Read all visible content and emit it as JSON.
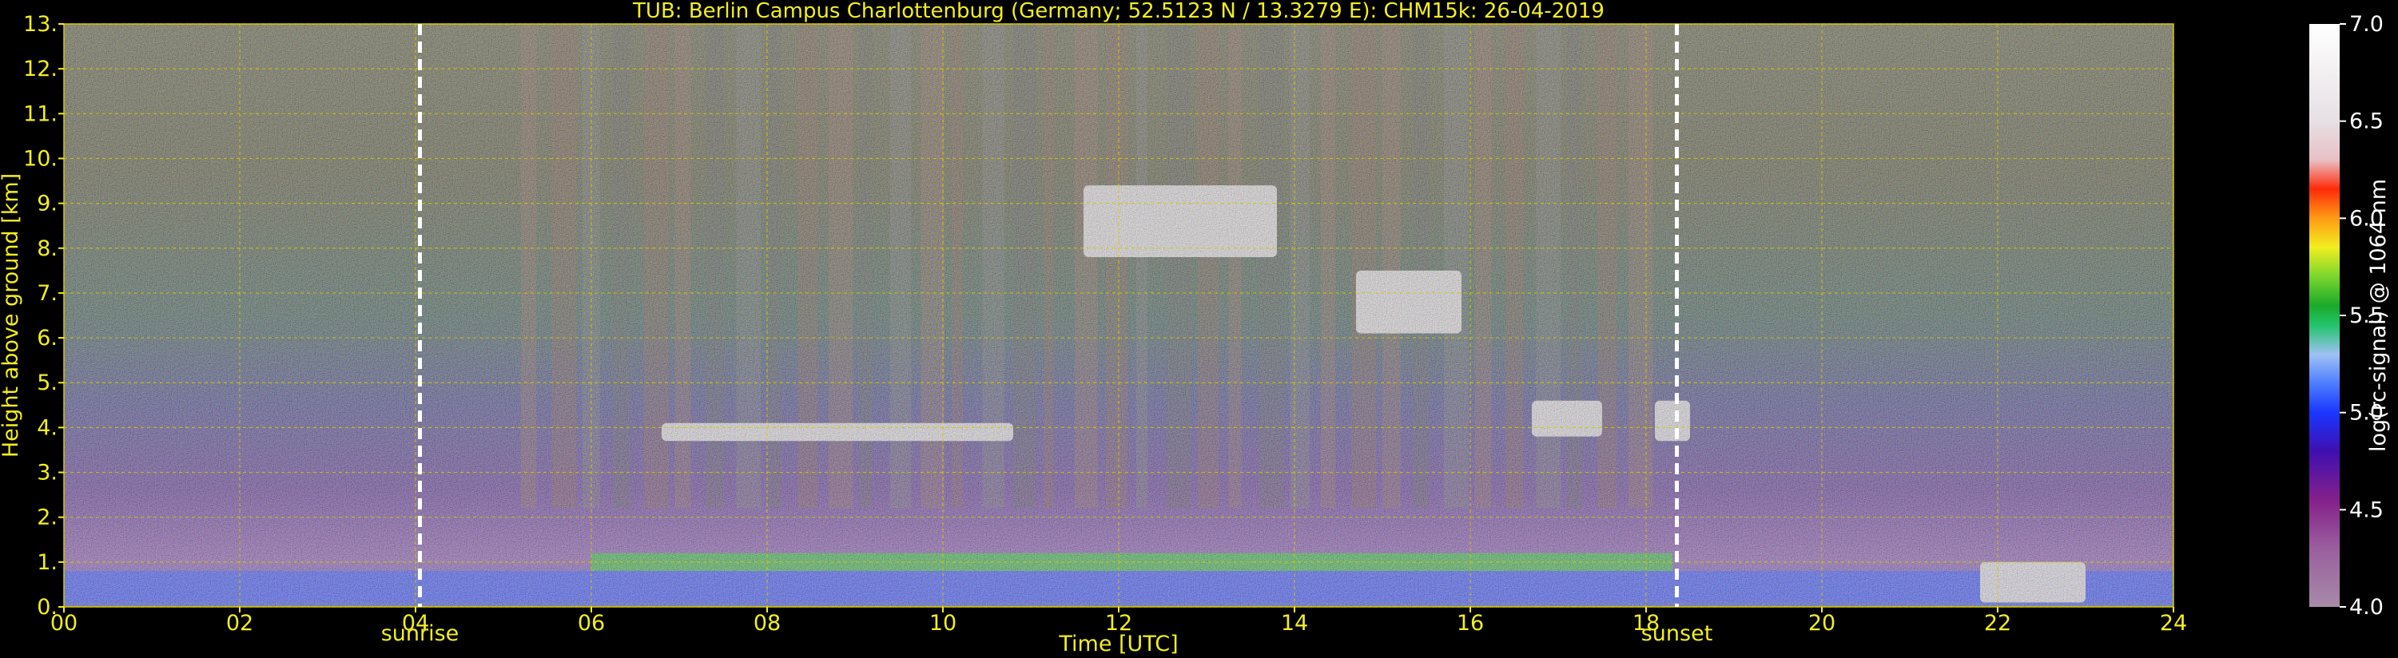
{
  "chart_data": {
    "type": "heatmap",
    "title": "TUB: Berlin Campus Charlottenburg (Germany; 52.5123 N / 13.3279 E):    CHM15k: 26-04-2019",
    "xlabel": "Time [UTC]",
    "ylabel": "Height above ground [km]",
    "xlim": [
      0,
      24
    ],
    "ylim": [
      0,
      13
    ],
    "x_ticks": [
      {
        "value": 0,
        "label": "00"
      },
      {
        "value": 2,
        "label": "02"
      },
      {
        "value": 4,
        "label": "04"
      },
      {
        "value": 6,
        "label": "06"
      },
      {
        "value": 8,
        "label": "08"
      },
      {
        "value": 10,
        "label": "10"
      },
      {
        "value": 12,
        "label": "12"
      },
      {
        "value": 14,
        "label": "14"
      },
      {
        "value": 16,
        "label": "16"
      },
      {
        "value": 18,
        "label": "18"
      },
      {
        "value": 20,
        "label": "20"
      },
      {
        "value": 22,
        "label": "22"
      },
      {
        "value": 24,
        "label": "24"
      }
    ],
    "y_ticks": [
      {
        "value": 0,
        "label": "0."
      },
      {
        "value": 1,
        "label": "1."
      },
      {
        "value": 2,
        "label": "2."
      },
      {
        "value": 3,
        "label": "3."
      },
      {
        "value": 4,
        "label": "4."
      },
      {
        "value": 5,
        "label": "5."
      },
      {
        "value": 6,
        "label": "6."
      },
      {
        "value": 7,
        "label": "7."
      },
      {
        "value": 8,
        "label": "8."
      },
      {
        "value": 9,
        "label": "9."
      },
      {
        "value": 10,
        "label": "10."
      },
      {
        "value": 11,
        "label": "11."
      },
      {
        "value": 12,
        "label": "12."
      },
      {
        "value": 13,
        "label": "13."
      }
    ],
    "grid": true,
    "grid_color": "#d4c800",
    "markers": [
      {
        "time": 4.05,
        "label": "sunrise"
      },
      {
        "time": 18.35,
        "label": "sunset"
      }
    ],
    "colorbar": {
      "label": "log(rc-signal) @ 1064 nm",
      "range": [
        4.0,
        7.0
      ],
      "ticks": [
        {
          "value": 4.0,
          "label": "4.0"
        },
        {
          "value": 4.5,
          "label": "4.5"
        },
        {
          "value": 5.0,
          "label": "5.0"
        },
        {
          "value": 5.5,
          "label": "5.5"
        },
        {
          "value": 6.0,
          "label": "6.0"
        },
        {
          "value": 6.5,
          "label": "6.5"
        },
        {
          "value": 7.0,
          "label": "7.0"
        }
      ],
      "stops": [
        {
          "value": 4.0,
          "color": "#a78aa8"
        },
        {
          "value": 4.3,
          "color": "#9a5f9e"
        },
        {
          "value": 4.55,
          "color": "#84208a"
        },
        {
          "value": 4.8,
          "color": "#3f0fb0"
        },
        {
          "value": 5.0,
          "color": "#1a36ff"
        },
        {
          "value": 5.15,
          "color": "#4d7dff"
        },
        {
          "value": 5.3,
          "color": "#9ec1f3"
        },
        {
          "value": 5.45,
          "color": "#22c46b"
        },
        {
          "value": 5.55,
          "color": "#1aaa2a"
        },
        {
          "value": 5.7,
          "color": "#7bd62d"
        },
        {
          "value": 5.85,
          "color": "#f2ee1f"
        },
        {
          "value": 6.0,
          "color": "#ff9a14"
        },
        {
          "value": 6.15,
          "color": "#ff2a0a"
        },
        {
          "value": 6.3,
          "color": "#e8c0c6"
        },
        {
          "value": 6.5,
          "color": "#e6e0e4"
        },
        {
          "value": 7.0,
          "color": "#ffffff"
        }
      ]
    },
    "features": [
      {
        "kind": "boundary_layer",
        "band": "green",
        "t_start": 6.0,
        "t_end": 18.3,
        "height_km": [
          0.8,
          1.2
        ]
      },
      {
        "kind": "boundary_layer",
        "band": "blue",
        "t_start": 0.0,
        "t_end": 24.0,
        "height_km": [
          0.1,
          0.8
        ]
      },
      {
        "kind": "cloud",
        "t_start": 6.8,
        "t_end": 10.8,
        "height_km": [
          3.7,
          4.1
        ]
      },
      {
        "kind": "cloud",
        "t_start": 11.6,
        "t_end": 13.8,
        "height_km": [
          7.8,
          9.4
        ]
      },
      {
        "kind": "cloud",
        "t_start": 14.7,
        "t_end": 15.9,
        "height_km": [
          6.1,
          7.5
        ]
      },
      {
        "kind": "cloud",
        "t_start": 16.7,
        "t_end": 17.5,
        "height_km": [
          3.8,
          4.6
        ]
      },
      {
        "kind": "cloud",
        "t_start": 18.1,
        "t_end": 18.5,
        "height_km": [
          3.7,
          4.6
        ]
      },
      {
        "kind": "cloud",
        "t_start": 21.8,
        "t_end": 23.0,
        "height_km": [
          0.1,
          1.0
        ]
      }
    ]
  },
  "icons": {
    "sunrise_marker": "dashed-white-vertical-line",
    "sunset_marker": "dashed-white-vertical-line"
  },
  "colors": {
    "background": "#000000",
    "text": "#f2ee1f",
    "colorbar_text": "#ffffff",
    "marker": "#ffffff"
  }
}
